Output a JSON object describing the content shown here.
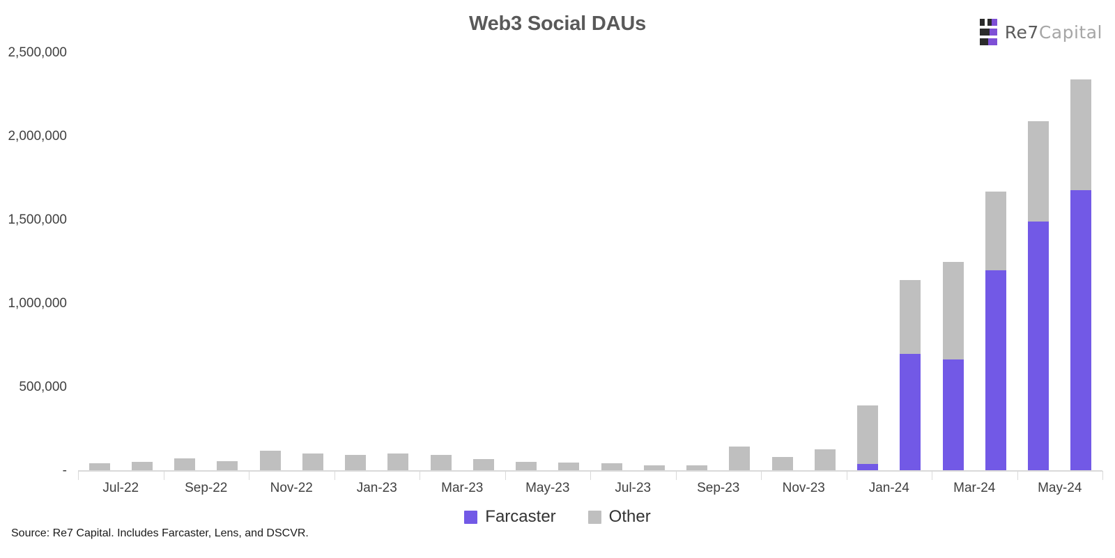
{
  "header": {
    "title": "Web3 Social DAUs",
    "brand": {
      "name_primary": "Re7",
      "name_secondary": "Capital",
      "mark_icon": "re7-logo-mark-icon"
    }
  },
  "footer": {
    "source": "Source: Re7 Capital. Includes Farcaster, Lens, and DSCVR."
  },
  "legend": {
    "position": "bottom-center",
    "items": [
      {
        "label": "Farcaster",
        "color": "#7259e6"
      },
      {
        "label": "Other",
        "color": "#bfbfbf"
      }
    ]
  },
  "colors": {
    "farcaster": "#7259e6",
    "other": "#bfbfbf",
    "axis": "#d9d9d9",
    "title": "#595959",
    "tick_text": "#404040",
    "brand_dark": "#2b2b2b",
    "brand_purple": "#7e4fd6"
  },
  "chart_data": {
    "type": "bar",
    "subtype": "stacked-vertical",
    "title": "Web3 Social DAUs",
    "subtitle": "",
    "xlabel": "",
    "ylabel": "",
    "ylim": [
      0,
      2500000
    ],
    "ytick_values": [
      0,
      500000,
      1000000,
      1500000,
      2000000,
      2500000
    ],
    "ytick_labels": [
      "-",
      "500,000",
      "1,000,000",
      "1,500,000",
      "2,000,000",
      "2,500,000"
    ],
    "grid": false,
    "legend_position": "bottom",
    "categories": [
      "Jul-22",
      "Aug-22",
      "Sep-22",
      "Oct-22",
      "Nov-22",
      "Dec-22",
      "Jan-23",
      "Feb-23",
      "Mar-23",
      "Apr-23",
      "May-23",
      "Jun-23",
      "Jul-23",
      "Aug-23",
      "Sep-23",
      "Oct-23",
      "Nov-23",
      "Dec-23",
      "Jan-24",
      "Feb-24",
      "Mar-24",
      "Apr-24",
      "May-24",
      "Jun-24"
    ],
    "xtick_labels": [
      "Jul-22",
      "Sep-22",
      "Nov-22",
      "Jan-23",
      "Mar-23",
      "May-23",
      "Jul-23",
      "Sep-23",
      "Nov-23",
      "Jan-24",
      "Mar-24",
      "May-24"
    ],
    "series": [
      {
        "name": "Farcaster",
        "color": "#7259e6",
        "values": [
          0,
          0,
          0,
          0,
          0,
          0,
          0,
          0,
          0,
          0,
          0,
          0,
          0,
          0,
          0,
          0,
          0,
          0,
          40000,
          700000,
          665000,
          1200000,
          1490000,
          1680000
        ]
      },
      {
        "name": "Other",
        "color": "#bfbfbf",
        "values": [
          45000,
          55000,
          75000,
          60000,
          120000,
          105000,
          95000,
          105000,
          95000,
          70000,
          55000,
          50000,
          45000,
          35000,
          35000,
          145000,
          85000,
          130000,
          350000,
          440000,
          585000,
          470000,
          600000,
          660000
        ]
      }
    ],
    "totals": [
      45000,
      55000,
      75000,
      60000,
      120000,
      105000,
      95000,
      105000,
      95000,
      70000,
      55000,
      50000,
      45000,
      35000,
      35000,
      145000,
      85000,
      130000,
      390000,
      1140000,
      1250000,
      1670000,
      2090000,
      2340000
    ]
  }
}
